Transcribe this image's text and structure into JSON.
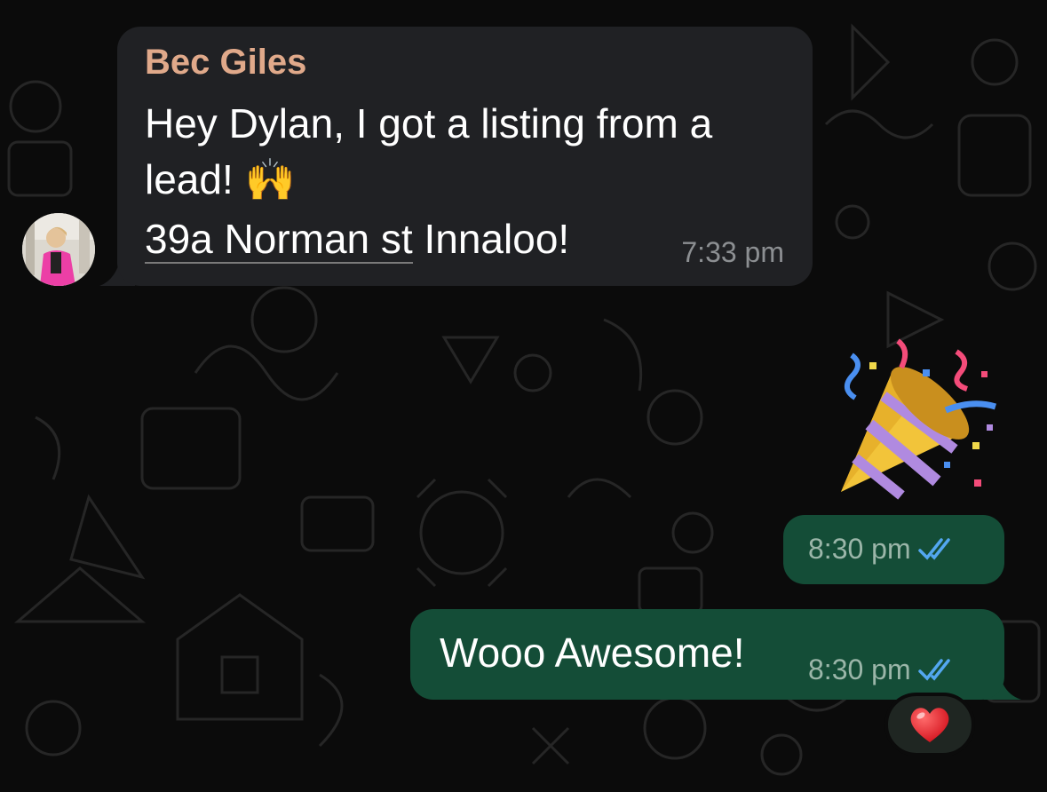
{
  "incoming": {
    "sender": "Bec Giles",
    "text": "Hey Dylan, I got a listing from a lead! 🙌",
    "link_text": "39a Norman st",
    "after_link": " Innaloo!",
    "time": "7:33 pm"
  },
  "outgoing": [
    {
      "text": "",
      "time": "8:30 pm",
      "status": "read",
      "content": "party-popper"
    },
    {
      "text": "Wooo Awesome!",
      "time": "8:30 pm",
      "status": "read"
    }
  ],
  "reaction": {
    "emoji": "❤️"
  },
  "colors": {
    "background": "#0b0b0b",
    "incoming_bubble": "#202124",
    "outgoing_bubble": "#144d37",
    "sender_name": "#e0a98a",
    "read_ticks": "#53a7f0"
  }
}
